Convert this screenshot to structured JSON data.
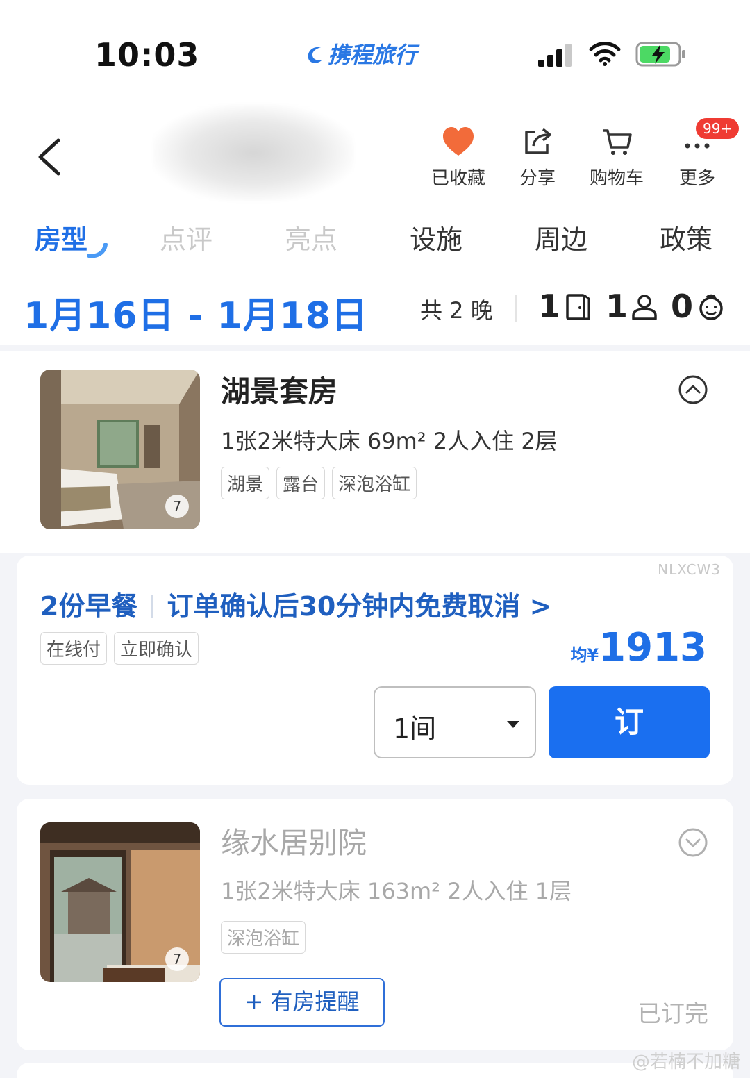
{
  "status": {
    "time": "10:03",
    "carrier": "携程旅行"
  },
  "nav": {
    "actions": [
      {
        "label": "已收藏",
        "icon": "heart-icon"
      },
      {
        "label": "分享",
        "icon": "share-icon"
      },
      {
        "label": "购物车",
        "icon": "cart-icon"
      },
      {
        "label": "更多",
        "icon": "more-icon"
      }
    ],
    "badge": "99+"
  },
  "tabs": [
    "房型",
    "点评",
    "亮点",
    "设施",
    "周边",
    "政策"
  ],
  "stay": {
    "dates": "1月16日 - 1月18日",
    "nights": "共 2 晚",
    "rooms": "1",
    "adults": "1",
    "children": "0"
  },
  "rooms": [
    {
      "name": "湖景套房",
      "info": "1张2米特大床  69m²  2人入住  2层",
      "tags": [
        "湖景",
        "露台",
        "深泡浴缸"
      ],
      "photo_count": "7",
      "offer": {
        "code": "NLXCW3",
        "title_a": "2份早餐",
        "title_b": "订单确认后30分钟内免费取消 >",
        "tags": [
          "在线付",
          "立即确认"
        ],
        "price_prefix": "均¥",
        "price": "1913",
        "qty": "1间",
        "book_label": "订"
      }
    },
    {
      "name": "缘水居别院",
      "info": "1张2米特大床  163m²  2人入住  1层",
      "tags": [
        "深泡浴缸"
      ],
      "photo_count": "7",
      "notify_label": "+ 有房提醒",
      "status": "已订完"
    }
  ],
  "watermark": "@若楠不加糖",
  "colors": {
    "accent": "#1f6fe6",
    "book": "#1a6ff0",
    "badge": "#ef3b33",
    "heart": "#f26b3a"
  }
}
